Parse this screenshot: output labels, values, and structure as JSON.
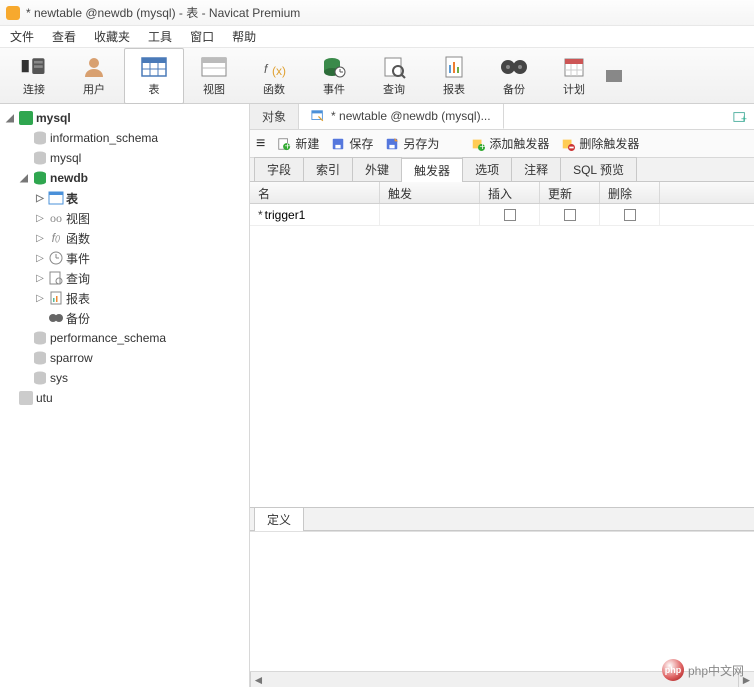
{
  "window": {
    "title": "* newtable @newdb (mysql) - 表 - Navicat Premium"
  },
  "menu": {
    "file": "文件",
    "view": "查看",
    "fav": "收藏夹",
    "tools": "工具",
    "window": "窗口",
    "help": "帮助"
  },
  "toolbar": {
    "connect": "连接",
    "user": "用户",
    "table": "表",
    "view": "视图",
    "function": "函数",
    "event": "事件",
    "query": "查询",
    "report": "报表",
    "backup": "备份",
    "schedule": "计划"
  },
  "tree": {
    "conn": "mysql",
    "dbs": {
      "info": "information_schema",
      "mysql": "mysql",
      "newdb": "newdb",
      "perf": "performance_schema",
      "sparrow": "sparrow",
      "sys": "sys"
    },
    "newdb_children": {
      "table": "表",
      "view": "视图",
      "func": "函数",
      "event": "事件",
      "query": "查询",
      "report": "报表",
      "backup": "备份"
    },
    "utu": "utu"
  },
  "tabs": {
    "objects": "对象",
    "editor": "* newtable @newdb (mysql)..."
  },
  "obj_toolbar": {
    "menu": "≡",
    "new": "新建",
    "save": "保存",
    "saveas": "另存为",
    "add_trigger": "添加触发器",
    "del_trigger": "删除触发器"
  },
  "sub_tabs": {
    "fields": "字段",
    "index": "索引",
    "fk": "外键",
    "trigger": "触发器",
    "options": "选项",
    "comment": "注释",
    "sql": "SQL 预览"
  },
  "grid": {
    "headers": {
      "name": "名",
      "trigger": "触发",
      "insert": "插入",
      "update": "更新",
      "delete": "删除"
    },
    "rows": [
      {
        "name": "trigger1",
        "marker": "*",
        "insert": false,
        "update": false,
        "delete": false
      }
    ]
  },
  "bottom": {
    "definition": "定义"
  },
  "watermark": "php中文网"
}
